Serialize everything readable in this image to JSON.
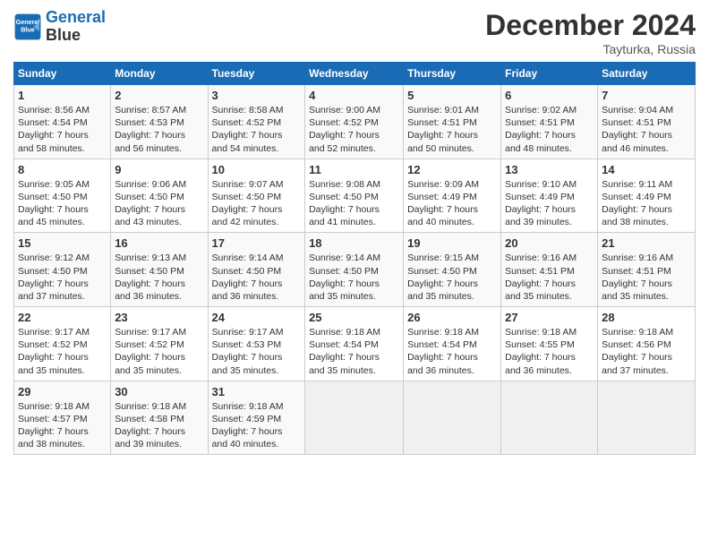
{
  "logo": {
    "line1": "General",
    "line2": "Blue"
  },
  "title": "December 2024",
  "subtitle": "Tayturka, Russia",
  "headers": [
    "Sunday",
    "Monday",
    "Tuesday",
    "Wednesday",
    "Thursday",
    "Friday",
    "Saturday"
  ],
  "weeks": [
    [
      {
        "day": "1",
        "info": "Sunrise: 8:56 AM\nSunset: 4:54 PM\nDaylight: 7 hours\nand 58 minutes."
      },
      {
        "day": "2",
        "info": "Sunrise: 8:57 AM\nSunset: 4:53 PM\nDaylight: 7 hours\nand 56 minutes."
      },
      {
        "day": "3",
        "info": "Sunrise: 8:58 AM\nSunset: 4:52 PM\nDaylight: 7 hours\nand 54 minutes."
      },
      {
        "day": "4",
        "info": "Sunrise: 9:00 AM\nSunset: 4:52 PM\nDaylight: 7 hours\nand 52 minutes."
      },
      {
        "day": "5",
        "info": "Sunrise: 9:01 AM\nSunset: 4:51 PM\nDaylight: 7 hours\nand 50 minutes."
      },
      {
        "day": "6",
        "info": "Sunrise: 9:02 AM\nSunset: 4:51 PM\nDaylight: 7 hours\nand 48 minutes."
      },
      {
        "day": "7",
        "info": "Sunrise: 9:04 AM\nSunset: 4:51 PM\nDaylight: 7 hours\nand 46 minutes."
      }
    ],
    [
      {
        "day": "8",
        "info": "Sunrise: 9:05 AM\nSunset: 4:50 PM\nDaylight: 7 hours\nand 45 minutes."
      },
      {
        "day": "9",
        "info": "Sunrise: 9:06 AM\nSunset: 4:50 PM\nDaylight: 7 hours\nand 43 minutes."
      },
      {
        "day": "10",
        "info": "Sunrise: 9:07 AM\nSunset: 4:50 PM\nDaylight: 7 hours\nand 42 minutes."
      },
      {
        "day": "11",
        "info": "Sunrise: 9:08 AM\nSunset: 4:50 PM\nDaylight: 7 hours\nand 41 minutes."
      },
      {
        "day": "12",
        "info": "Sunrise: 9:09 AM\nSunset: 4:49 PM\nDaylight: 7 hours\nand 40 minutes."
      },
      {
        "day": "13",
        "info": "Sunrise: 9:10 AM\nSunset: 4:49 PM\nDaylight: 7 hours\nand 39 minutes."
      },
      {
        "day": "14",
        "info": "Sunrise: 9:11 AM\nSunset: 4:49 PM\nDaylight: 7 hours\nand 38 minutes."
      }
    ],
    [
      {
        "day": "15",
        "info": "Sunrise: 9:12 AM\nSunset: 4:50 PM\nDaylight: 7 hours\nand 37 minutes."
      },
      {
        "day": "16",
        "info": "Sunrise: 9:13 AM\nSunset: 4:50 PM\nDaylight: 7 hours\nand 36 minutes."
      },
      {
        "day": "17",
        "info": "Sunrise: 9:14 AM\nSunset: 4:50 PM\nDaylight: 7 hours\nand 36 minutes."
      },
      {
        "day": "18",
        "info": "Sunrise: 9:14 AM\nSunset: 4:50 PM\nDaylight: 7 hours\nand 35 minutes."
      },
      {
        "day": "19",
        "info": "Sunrise: 9:15 AM\nSunset: 4:50 PM\nDaylight: 7 hours\nand 35 minutes."
      },
      {
        "day": "20",
        "info": "Sunrise: 9:16 AM\nSunset: 4:51 PM\nDaylight: 7 hours\nand 35 minutes."
      },
      {
        "day": "21",
        "info": "Sunrise: 9:16 AM\nSunset: 4:51 PM\nDaylight: 7 hours\nand 35 minutes."
      }
    ],
    [
      {
        "day": "22",
        "info": "Sunrise: 9:17 AM\nSunset: 4:52 PM\nDaylight: 7 hours\nand 35 minutes."
      },
      {
        "day": "23",
        "info": "Sunrise: 9:17 AM\nSunset: 4:52 PM\nDaylight: 7 hours\nand 35 minutes."
      },
      {
        "day": "24",
        "info": "Sunrise: 9:17 AM\nSunset: 4:53 PM\nDaylight: 7 hours\nand 35 minutes."
      },
      {
        "day": "25",
        "info": "Sunrise: 9:18 AM\nSunset: 4:54 PM\nDaylight: 7 hours\nand 35 minutes."
      },
      {
        "day": "26",
        "info": "Sunrise: 9:18 AM\nSunset: 4:54 PM\nDaylight: 7 hours\nand 36 minutes."
      },
      {
        "day": "27",
        "info": "Sunrise: 9:18 AM\nSunset: 4:55 PM\nDaylight: 7 hours\nand 36 minutes."
      },
      {
        "day": "28",
        "info": "Sunrise: 9:18 AM\nSunset: 4:56 PM\nDaylight: 7 hours\nand 37 minutes."
      }
    ],
    [
      {
        "day": "29",
        "info": "Sunrise: 9:18 AM\nSunset: 4:57 PM\nDaylight: 7 hours\nand 38 minutes."
      },
      {
        "day": "30",
        "info": "Sunrise: 9:18 AM\nSunset: 4:58 PM\nDaylight: 7 hours\nand 39 minutes."
      },
      {
        "day": "31",
        "info": "Sunrise: 9:18 AM\nSunset: 4:59 PM\nDaylight: 7 hours\nand 40 minutes."
      },
      null,
      null,
      null,
      null
    ]
  ]
}
